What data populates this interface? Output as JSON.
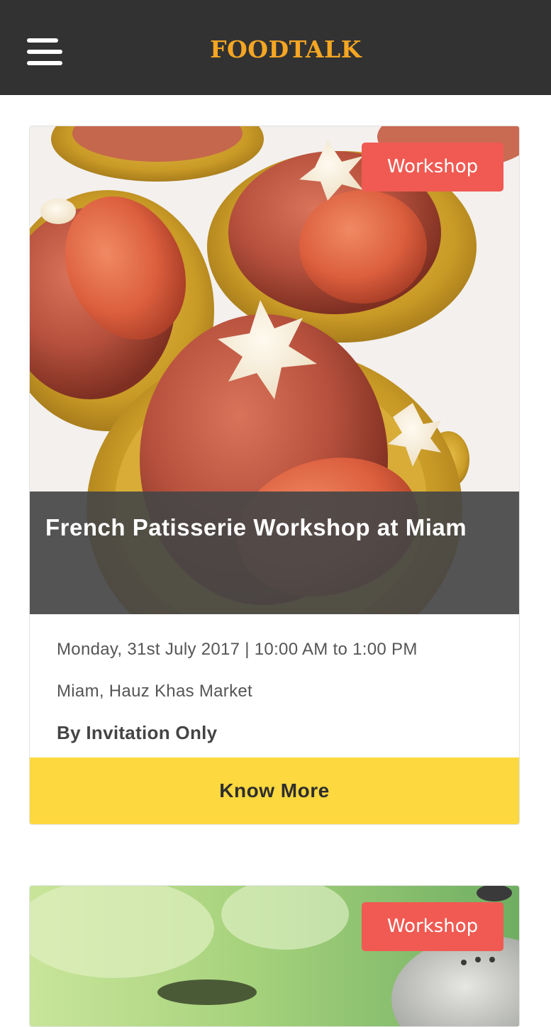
{
  "header": {
    "brand": "FOODTALK",
    "menu_icon": "hamburger-menu-icon"
  },
  "events": [
    {
      "category": "Workshop",
      "title": "French Patisserie Workshop at Miam",
      "datetime": "Monday, 31st July 2017 | 10:00 AM to 1:00 PM",
      "venue": "Miam, Hauz Khas Market",
      "access": "By Invitation Only",
      "cta_label": "Know More"
    },
    {
      "category": "Workshop"
    }
  ],
  "colors": {
    "header_bg": "#323232",
    "brand": "#f5a623",
    "badge": "#f05a52",
    "cta": "#fdd83e"
  }
}
